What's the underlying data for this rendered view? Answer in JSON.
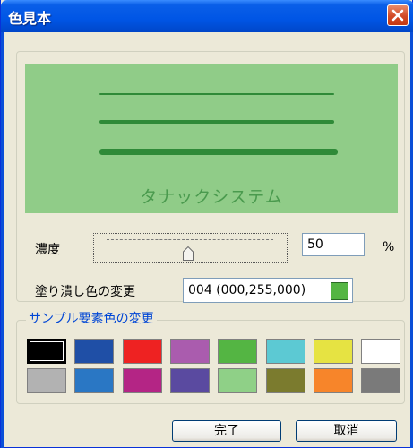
{
  "window": {
    "title": "色見本"
  },
  "preview": {
    "caption": "タナックシステム",
    "background": "#90cc88",
    "line_color": "#2f8a38"
  },
  "density": {
    "label": "濃度",
    "value": "50",
    "unit": "%",
    "slider_level": 0.5
  },
  "change_fill": {
    "label": "塗り潰し色の変更",
    "value": "004 (000,255,000)",
    "color": "#54b543"
  },
  "sample_section": {
    "title": "サンプル要素色の変更",
    "row1": [
      "#000000",
      "#1f4fa6",
      "#ee2222",
      "#aa5cae",
      "#54b543",
      "#5cc9d3",
      "#e6e342",
      "#ffffff"
    ],
    "row2": [
      "#b2b2b2",
      "#2a77c4",
      "#b42585",
      "#5a4aa0",
      "#8fd087",
      "#7b7b2e",
      "#f7852a",
      "#7a7a7a"
    ],
    "selected": "#000000"
  },
  "buttons": {
    "ok": "完了",
    "cancel": "取消"
  }
}
